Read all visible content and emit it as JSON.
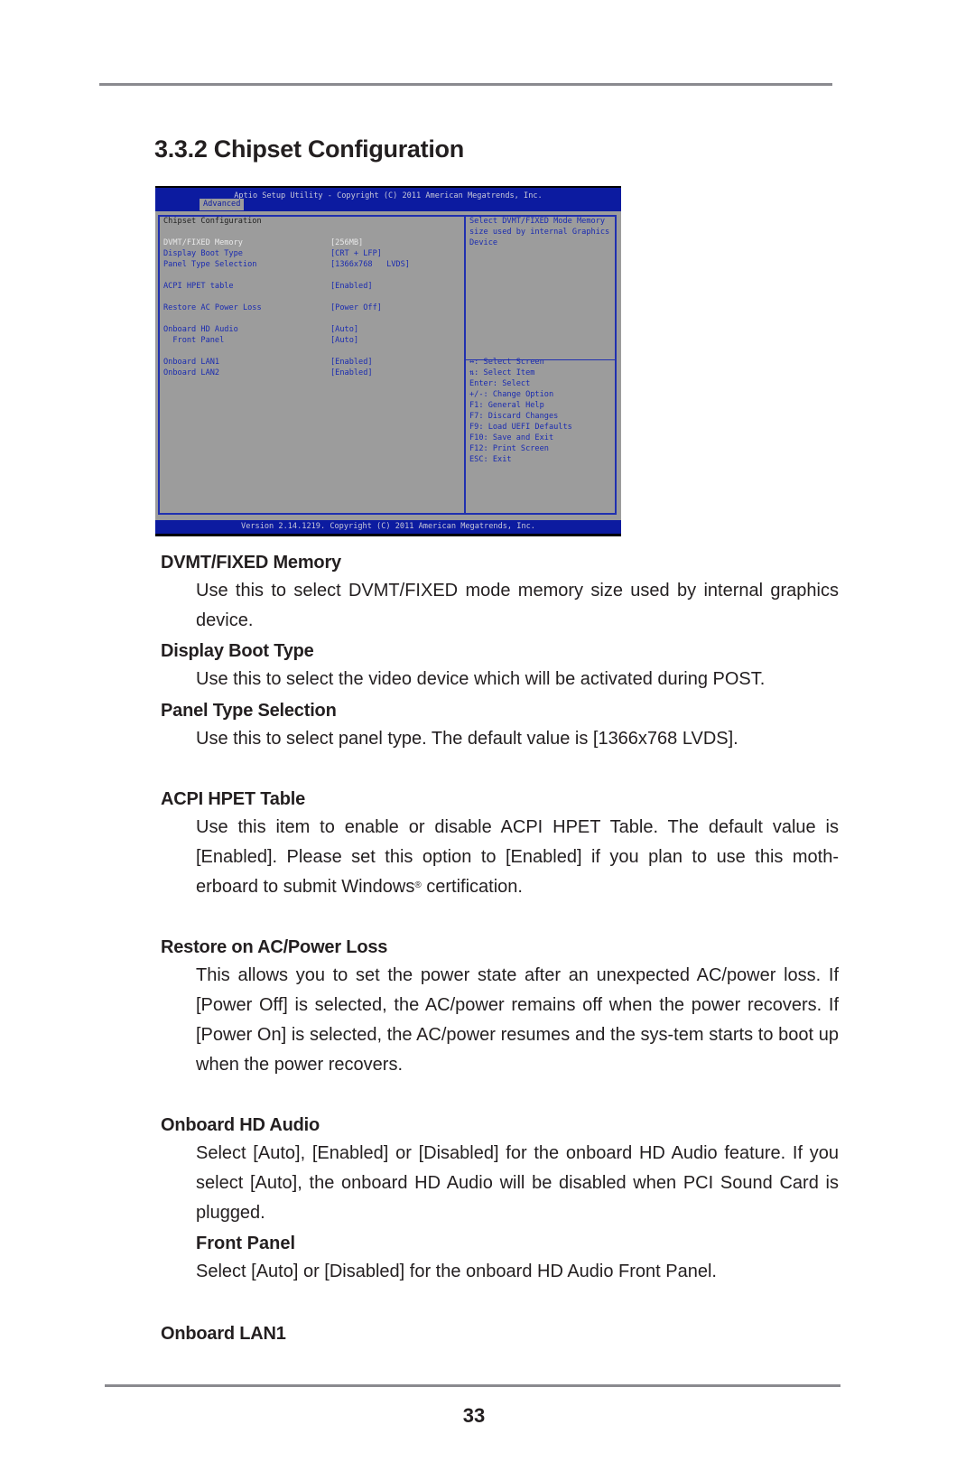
{
  "page": {
    "title": "3.3.2  Chipset Configuration",
    "page_number": "33"
  },
  "bios": {
    "header": "Aptio Setup Utility - Copyright (C) 2011 American Megatrends, Inc.",
    "active_tab": "Advanced",
    "section_title": "Chipset Configuration",
    "items": [
      {
        "label": "DVMT/FIXED Memory",
        "value": "[256MB]",
        "selected": true
      },
      {
        "label": "Display Boot Type",
        "value": "[CRT + LFP]"
      },
      {
        "label": "Panel Type Selection",
        "value": "[1366x768   LVDS]"
      },
      {
        "label": "ACPI HPET table",
        "value": "[Enabled]"
      },
      {
        "label": "Restore AC Power Loss",
        "value": "[Power Off]"
      },
      {
        "label": "Onboard HD Audio",
        "value": "[Auto]"
      },
      {
        "label": "  Front Panel",
        "value": "[Auto]"
      },
      {
        "label": "Onboard LAN1",
        "value": "[Enabled]"
      },
      {
        "label": "Onboard LAN2",
        "value": "[Enabled]"
      }
    ],
    "help_text": [
      "Select DVMT/FIXED Mode Memory",
      "size used by internal Graphics",
      "Device"
    ],
    "key_help": [
      "↔: Select Screen",
      "⇅: Select Item",
      "Enter: Select",
      "+/-: Change Option",
      "F1: General Help",
      "F7: Discard Changes",
      "F9: Load UEFI Defaults",
      "F10: Save and Exit",
      "F12: Print Screen",
      "ESC: Exit"
    ],
    "footer": "Version 2.14.1219. Copyright (C) 2011 American Megatrends, Inc.",
    "colors": {
      "bar": "#0c1ba0",
      "panel": "#9c9c9c",
      "item_text": "#1a2bb0",
      "selected_text": "#e8e8e8"
    }
  },
  "sections": {
    "dvmt": {
      "heading": "DVMT/FIXED Memory",
      "text": "Use this to select DVMT/FIXED mode memory size used by internal graphics device."
    },
    "display_boot": {
      "heading": "Display Boot Type",
      "text": "Use this to select the video device which will be activated during POST."
    },
    "panel_type": {
      "heading": "Panel Type Selection",
      "text": "Use this to select panel type. The default value is [1366x768 LVDS]."
    },
    "acpi_hpet": {
      "heading": "ACPI HPET Table",
      "text_before": "Use this item to enable or disable ACPI HPET Table. The default value is [Enabled]. Please set this option to [Enabled] if you plan to use this moth-erboard to submit Windows",
      "sup": "®",
      "text_after": " certification."
    },
    "restore_ac": {
      "heading": "Restore on AC/Power Loss",
      "text": "This allows you to set the power state after an unexpected AC/power loss. If [Power Off] is selected, the AC/power remains off when the power recovers. If [Power On] is selected, the AC/power resumes and the sys-tem starts to boot up when the power recovers."
    },
    "hd_audio": {
      "heading": "Onboard HD Audio",
      "text": "Select [Auto], [Enabled] or [Disabled] for the onboard HD Audio feature. If you select [Auto], the onboard HD Audio will be disabled when PCI Sound Card is plugged."
    },
    "front_panel": {
      "heading": "Front Panel",
      "text": "Select [Auto] or [Disabled] for the onboard HD Audio Front Panel."
    },
    "lan1": {
      "heading": "Onboard LAN1"
    }
  }
}
